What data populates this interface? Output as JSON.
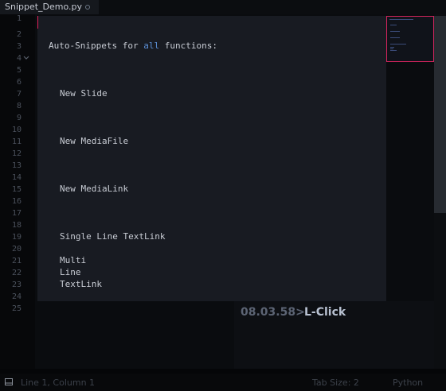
{
  "tab": {
    "title": "Snippet_Demo.py"
  },
  "gutter": {
    "lines": [
      "1",
      "2",
      "3",
      "4",
      "5",
      "6",
      "7",
      "8",
      "9",
      "10",
      "11",
      "12",
      "13",
      "14",
      "15",
      "16",
      "17",
      "18",
      "19",
      "20",
      "21",
      "22",
      "23",
      "24",
      "25"
    ]
  },
  "popup": {
    "heading_prefix": "Auto-Snippets for ",
    "heading_keyword": "all",
    "heading_suffix": " functions:",
    "items": {
      "new_slide": "New Slide",
      "new_mediafile": "New MediaFile",
      "new_medialink": "New MediaLink",
      "single_line_textlink": "Single Line TextLink",
      "multi": "Multi",
      "line": "Line",
      "textlink": "TextLink"
    }
  },
  "key_overlay": {
    "time": "08.03.58>",
    "action": "L-Click"
  },
  "status": {
    "position": "Line 1, Column 1",
    "tab_size": "Tab Size: 2",
    "syntax": "Python"
  },
  "colors": {
    "accent": "#e0205a",
    "keyword": "#5b8fd6"
  }
}
